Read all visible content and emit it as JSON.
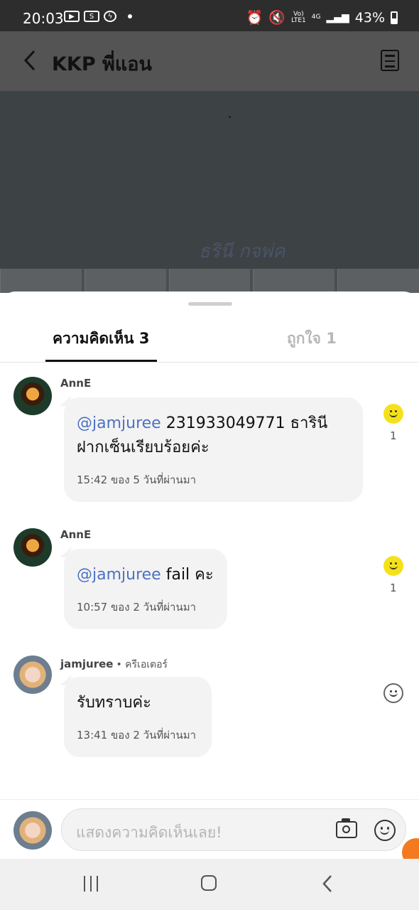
{
  "status_bar": {
    "time": "20:03",
    "battery": "43%",
    "network_top": "Vo)\nLTE1",
    "network_4g": "4G"
  },
  "header": {
    "title": "KKP พี่แอน"
  },
  "tabs": [
    {
      "label": "ความคิดเห็น 3"
    },
    {
      "label": "ถูกใจ 1"
    }
  ],
  "comments": [
    {
      "author": "AnnE",
      "mention": "@jamjuree",
      "text": " 231933049771 ธารินี ฝากเซ็นเรียบร้อยค่ะ",
      "meta": "15:42 ของ 5 วันที่ผ่านมา",
      "reactions": "1"
    },
    {
      "author": "AnnE",
      "mention": "@jamjuree",
      "text": " fail คะ",
      "meta": "10:57 ของ 2 วันที่ผ่านมา",
      "reactions": "1"
    },
    {
      "author": "jamjuree",
      "badge": "• ครีเอเตอร์",
      "text": "รับทราบค่ะ",
      "meta": "13:41 ของ 2 วันที่ผ่านมา"
    }
  ],
  "input": {
    "placeholder": "แสดงความคิดเห็นเลย!"
  },
  "colors": {
    "mention": "#4d72c4",
    "reaction": "#f5e11a",
    "fab": "#f47a20"
  }
}
